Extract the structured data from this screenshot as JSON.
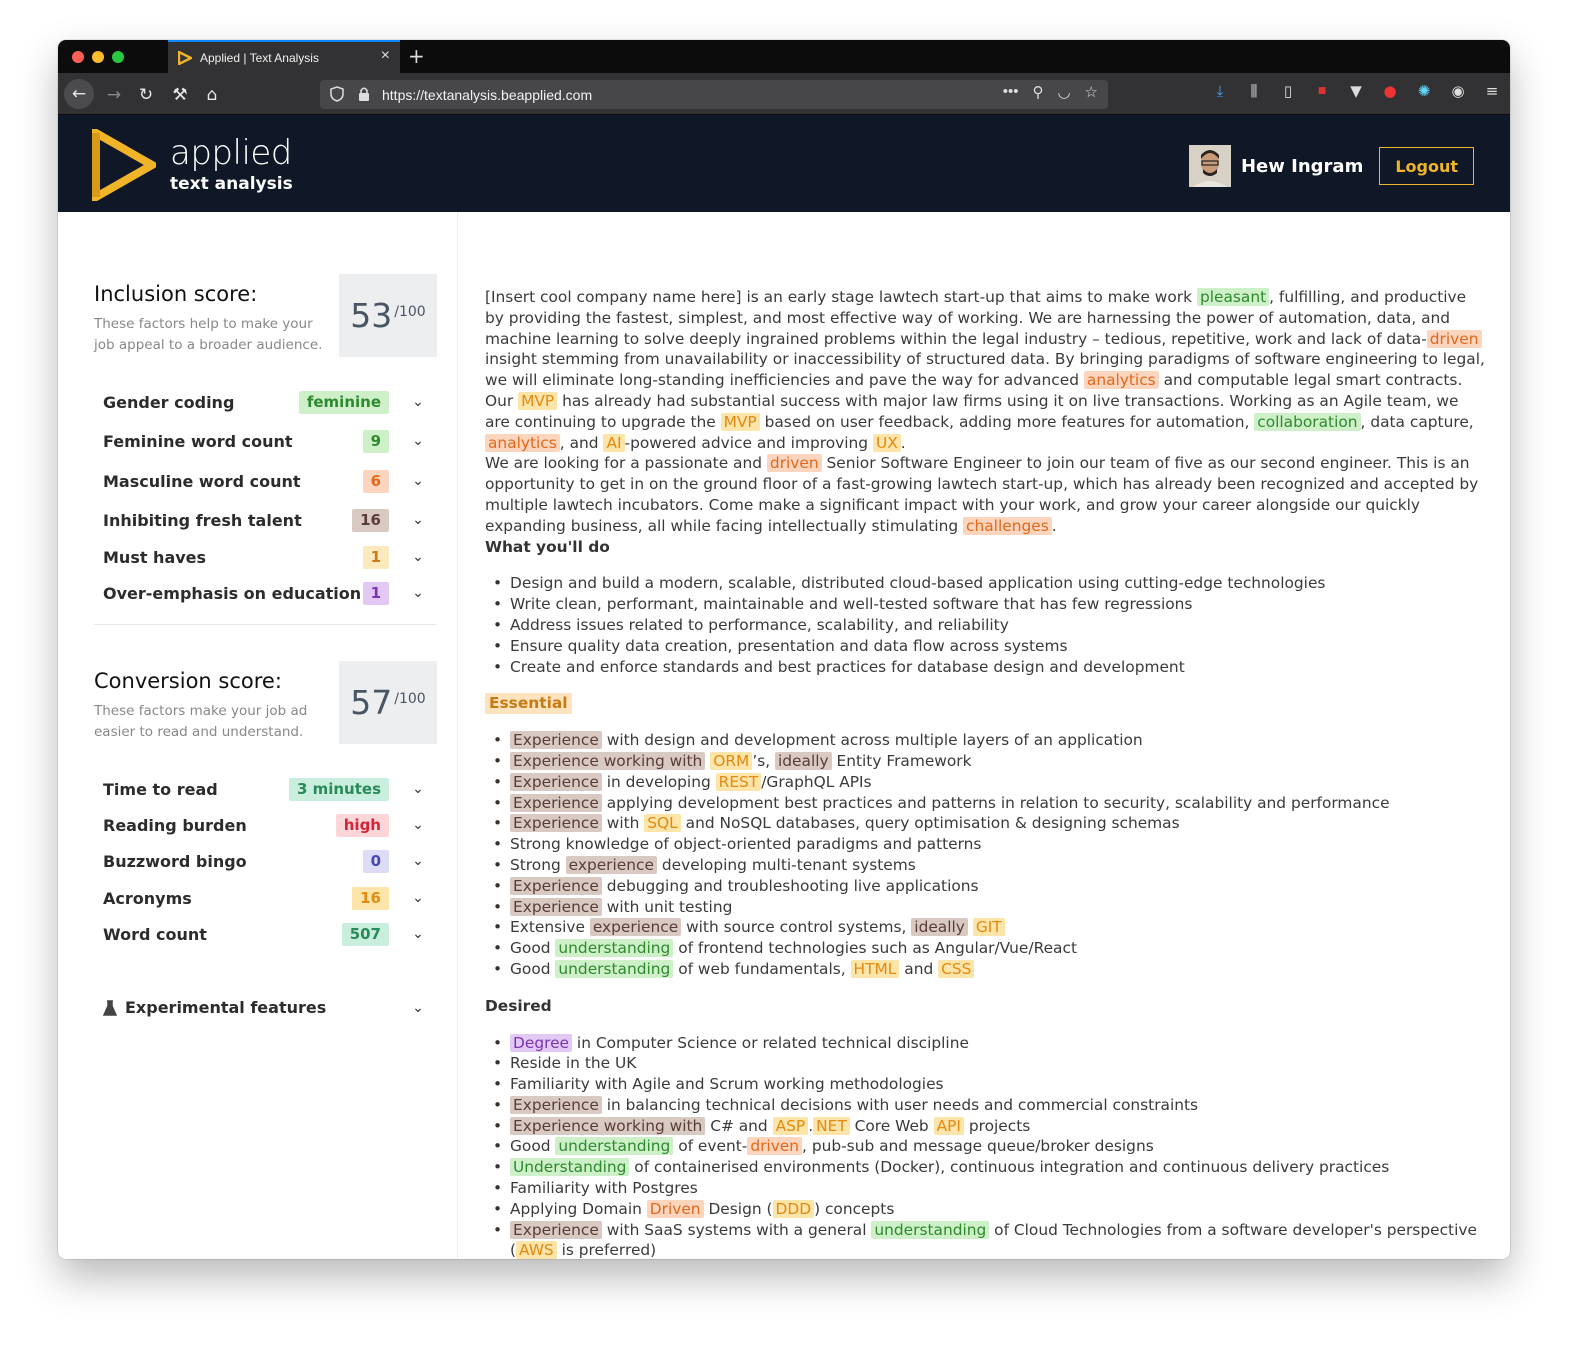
{
  "browser": {
    "tab_title": "Applied | Text Analysis",
    "url": "https://textanalysis.beapplied.com"
  },
  "header": {
    "logo_main": "applied",
    "logo_sub": "text analysis",
    "user_name": "Hew Ingram",
    "logout_label": "Logout"
  },
  "inclusion": {
    "title": "Inclusion score",
    "description": "These factors help to make your job appeal to a broader audience.",
    "score": "53",
    "denominator": "/100",
    "metrics": [
      {
        "label": "Gender coding",
        "value": "feminine"
      },
      {
        "label": "Feminine word count",
        "value": "9"
      },
      {
        "label": "Masculine word count",
        "value": "6"
      },
      {
        "label": "Inhibiting fresh talent",
        "value": "16"
      },
      {
        "label": "Must haves",
        "value": "1"
      },
      {
        "label": "Over-emphasis on education",
        "value": "1"
      }
    ]
  },
  "conversion": {
    "title": "Conversion score",
    "description": "These factors make your job ad easier to read and understand.",
    "score": "57",
    "denominator": "/100",
    "metrics": [
      {
        "label": "Time to read",
        "value": "3 minutes"
      },
      {
        "label": "Reading burden",
        "value": "high"
      },
      {
        "label": "Buzzword bingo",
        "value": "0"
      },
      {
        "label": "Acronyms",
        "value": "16"
      },
      {
        "label": "Word count",
        "value": "507"
      }
    ]
  },
  "experimental_label": "Experimental features",
  "highlight_colors": {
    "feminine": "#cdf0c8",
    "masculine": "#fcd5bf",
    "acronym": "#fde4a8",
    "inhibiting": "#d9c9c3",
    "education": "#e1c9f3"
  },
  "document": {
    "intro": [
      {
        "t": "[Insert cool company name here] is an early stage lawtech start-up that  aims to make work "
      },
      {
        "t": "pleasant",
        "c": "g"
      },
      {
        "t": ", fulfilling, and productive by providing the  fastest, simplest, and most effective way of working. We are harnessing  the power of automation, data, and machine learning to solve deeply  ingrained problems within the legal industry – tedious, repetitive, work  and lack of data-"
      },
      {
        "t": "driven",
        "c": "o"
      },
      {
        "t": " insight stemming from unavailability or  inaccessibility of structured data. By bringing paradigms of software  engineering to legal, we will eliminate long-standing inefficiencies and  pave the way for advanced "
      },
      {
        "t": "analytics",
        "c": "o"
      },
      {
        "t": " and computable legal smart  contracts. Our "
      },
      {
        "t": "MVP",
        "c": "y"
      },
      {
        "t": " has already had substantial success with major law firms  using it on live transactions. Working as an Agile team, we are continuing to upgrade the "
      },
      {
        "t": "MVP",
        "c": "y"
      },
      {
        "t": " based on user feedback, adding more  features for automation, "
      },
      {
        "t": "collaboration",
        "c": "g"
      },
      {
        "t": ", data capture, "
      },
      {
        "t": "analytics",
        "c": "o"
      },
      {
        "t": ", and "
      },
      {
        "t": "AI",
        "c": "y"
      },
      {
        "t": "-powered advice and improving "
      },
      {
        "t": "UX",
        "c": "y"
      },
      {
        "t": "."
      }
    ],
    "intro2": [
      {
        "t": "We are looking for a passionate and "
      },
      {
        "t": "driven",
        "c": "o"
      },
      {
        "t": " Senior Software Engineer to join our team of five as our second engineer. This is an opportunity  to get in on the ground floor of a fast-growing lawtech start-up, which  has already been recognized and accepted by multiple lawtech incubators.  Come make a significant impact with your work, and grow your career  alongside our quickly expanding business, all while facing  intellectually stimulating "
      },
      {
        "t": "challenges",
        "c": "o"
      },
      {
        "t": "."
      }
    ],
    "what_heading": "What you'll do",
    "what_items": [
      [
        {
          "t": "Design and build a modern, scalable, distributed cloud-based application using cutting-edge technologies"
        }
      ],
      [
        {
          "t": "Write clean, performant, maintainable and well-tested software that has few regressions"
        }
      ],
      [
        {
          "t": "Address issues related to performance, scalability, and reliability"
        }
      ],
      [
        {
          "t": "Ensure quality data creation, presentation and data flow across systems"
        }
      ],
      [
        {
          "t": "Create and enforce standards and best practices for database design and development"
        }
      ]
    ],
    "essential_heading": "Essential",
    "essential_items": [
      [
        {
          "t": "Experience",
          "c": "b"
        },
        {
          "t": " with design and development across multiple layers of an application"
        }
      ],
      [
        {
          "t": "Experience working with",
          "c": "b"
        },
        {
          "t": " "
        },
        {
          "t": "ORM",
          "c": "y"
        },
        {
          "t": "’s, "
        },
        {
          "t": "ideally",
          "c": "b"
        },
        {
          "t": " Entity Framework"
        }
      ],
      [
        {
          "t": "Experience",
          "c": "b"
        },
        {
          "t": " in developing "
        },
        {
          "t": "REST",
          "c": "y"
        },
        {
          "t": "/GraphQL APIs"
        }
      ],
      [
        {
          "t": "Experience",
          "c": "b"
        },
        {
          "t": " applying development best practices and patterns in relation to security, scalability and performance"
        }
      ],
      [
        {
          "t": "Experience",
          "c": "b"
        },
        {
          "t": " with "
        },
        {
          "t": "SQL",
          "c": "y"
        },
        {
          "t": " and NoSQL databases, query optimisation & designing schemas"
        }
      ],
      [
        {
          "t": "Strong knowledge of object-oriented paradigms and patterns"
        }
      ],
      [
        {
          "t": "Strong "
        },
        {
          "t": "experience",
          "c": "b"
        },
        {
          "t": " developing multi-tenant systems"
        }
      ],
      [
        {
          "t": "Experience",
          "c": "b"
        },
        {
          "t": " debugging and troubleshooting live applications"
        }
      ],
      [
        {
          "t": "Experience",
          "c": "b"
        },
        {
          "t": " with unit testing"
        }
      ],
      [
        {
          "t": "Extensive "
        },
        {
          "t": "experience",
          "c": "b"
        },
        {
          "t": " with source control systems, "
        },
        {
          "t": "ideally",
          "c": "b"
        },
        {
          "t": " "
        },
        {
          "t": "GIT",
          "c": "y"
        }
      ],
      [
        {
          "t": "Good "
        },
        {
          "t": "understanding",
          "c": "g"
        },
        {
          "t": " of frontend technologies such as Angular/Vue/React"
        }
      ],
      [
        {
          "t": "Good "
        },
        {
          "t": "understanding",
          "c": "g"
        },
        {
          "t": " of web fundamentals, "
        },
        {
          "t": "HTML",
          "c": "y"
        },
        {
          "t": " and "
        },
        {
          "t": "CSS",
          "c": "y"
        }
      ]
    ],
    "desired_heading": "Desired",
    "desired_items": [
      [
        {
          "t": "Degree",
          "c": "p"
        },
        {
          "t": " in Computer Science or related technical discipline"
        }
      ],
      [
        {
          "t": "Reside in the UK"
        }
      ],
      [
        {
          "t": "Familiarity with Agile and Scrum working methodologies"
        }
      ],
      [
        {
          "t": "Experience",
          "c": "b"
        },
        {
          "t": " in balancing technical decisions with user needs and commercial constraints"
        }
      ],
      [
        {
          "t": "Experience working with",
          "c": "b"
        },
        {
          "t": " C# and "
        },
        {
          "t": "ASP",
          "c": "y"
        },
        {
          "t": "."
        },
        {
          "t": "NET",
          "c": "y"
        },
        {
          "t": " Core Web "
        },
        {
          "t": "API",
          "c": "y"
        },
        {
          "t": " projects"
        }
      ],
      [
        {
          "t": "Good "
        },
        {
          "t": "understanding",
          "c": "g"
        },
        {
          "t": " of event-"
        },
        {
          "t": "driven",
          "c": "o"
        },
        {
          "t": ", pub-sub and message queue/broker designs"
        }
      ],
      [
        {
          "t": "Understanding",
          "c": "g"
        },
        {
          "t": " of containerised environments (Docker), continuous integration and continuous delivery practices"
        }
      ],
      [
        {
          "t": "Familiarity with Postgres"
        }
      ],
      [
        {
          "t": "Applying Domain "
        },
        {
          "t": "Driven",
          "c": "o"
        },
        {
          "t": " Design ("
        },
        {
          "t": "DDD",
          "c": "y"
        },
        {
          "t": ") concepts"
        }
      ],
      [
        {
          "t": "Experience",
          "c": "b"
        },
        {
          "t": " with SaaS systems with a general "
        },
        {
          "t": "understanding",
          "c": "g"
        },
        {
          "t": " of Cloud  Technologies from a software developer's perspective ("
        },
        {
          "t": "AWS",
          "c": "y"
        },
        {
          "t": " is preferred)"
        }
      ]
    ]
  }
}
